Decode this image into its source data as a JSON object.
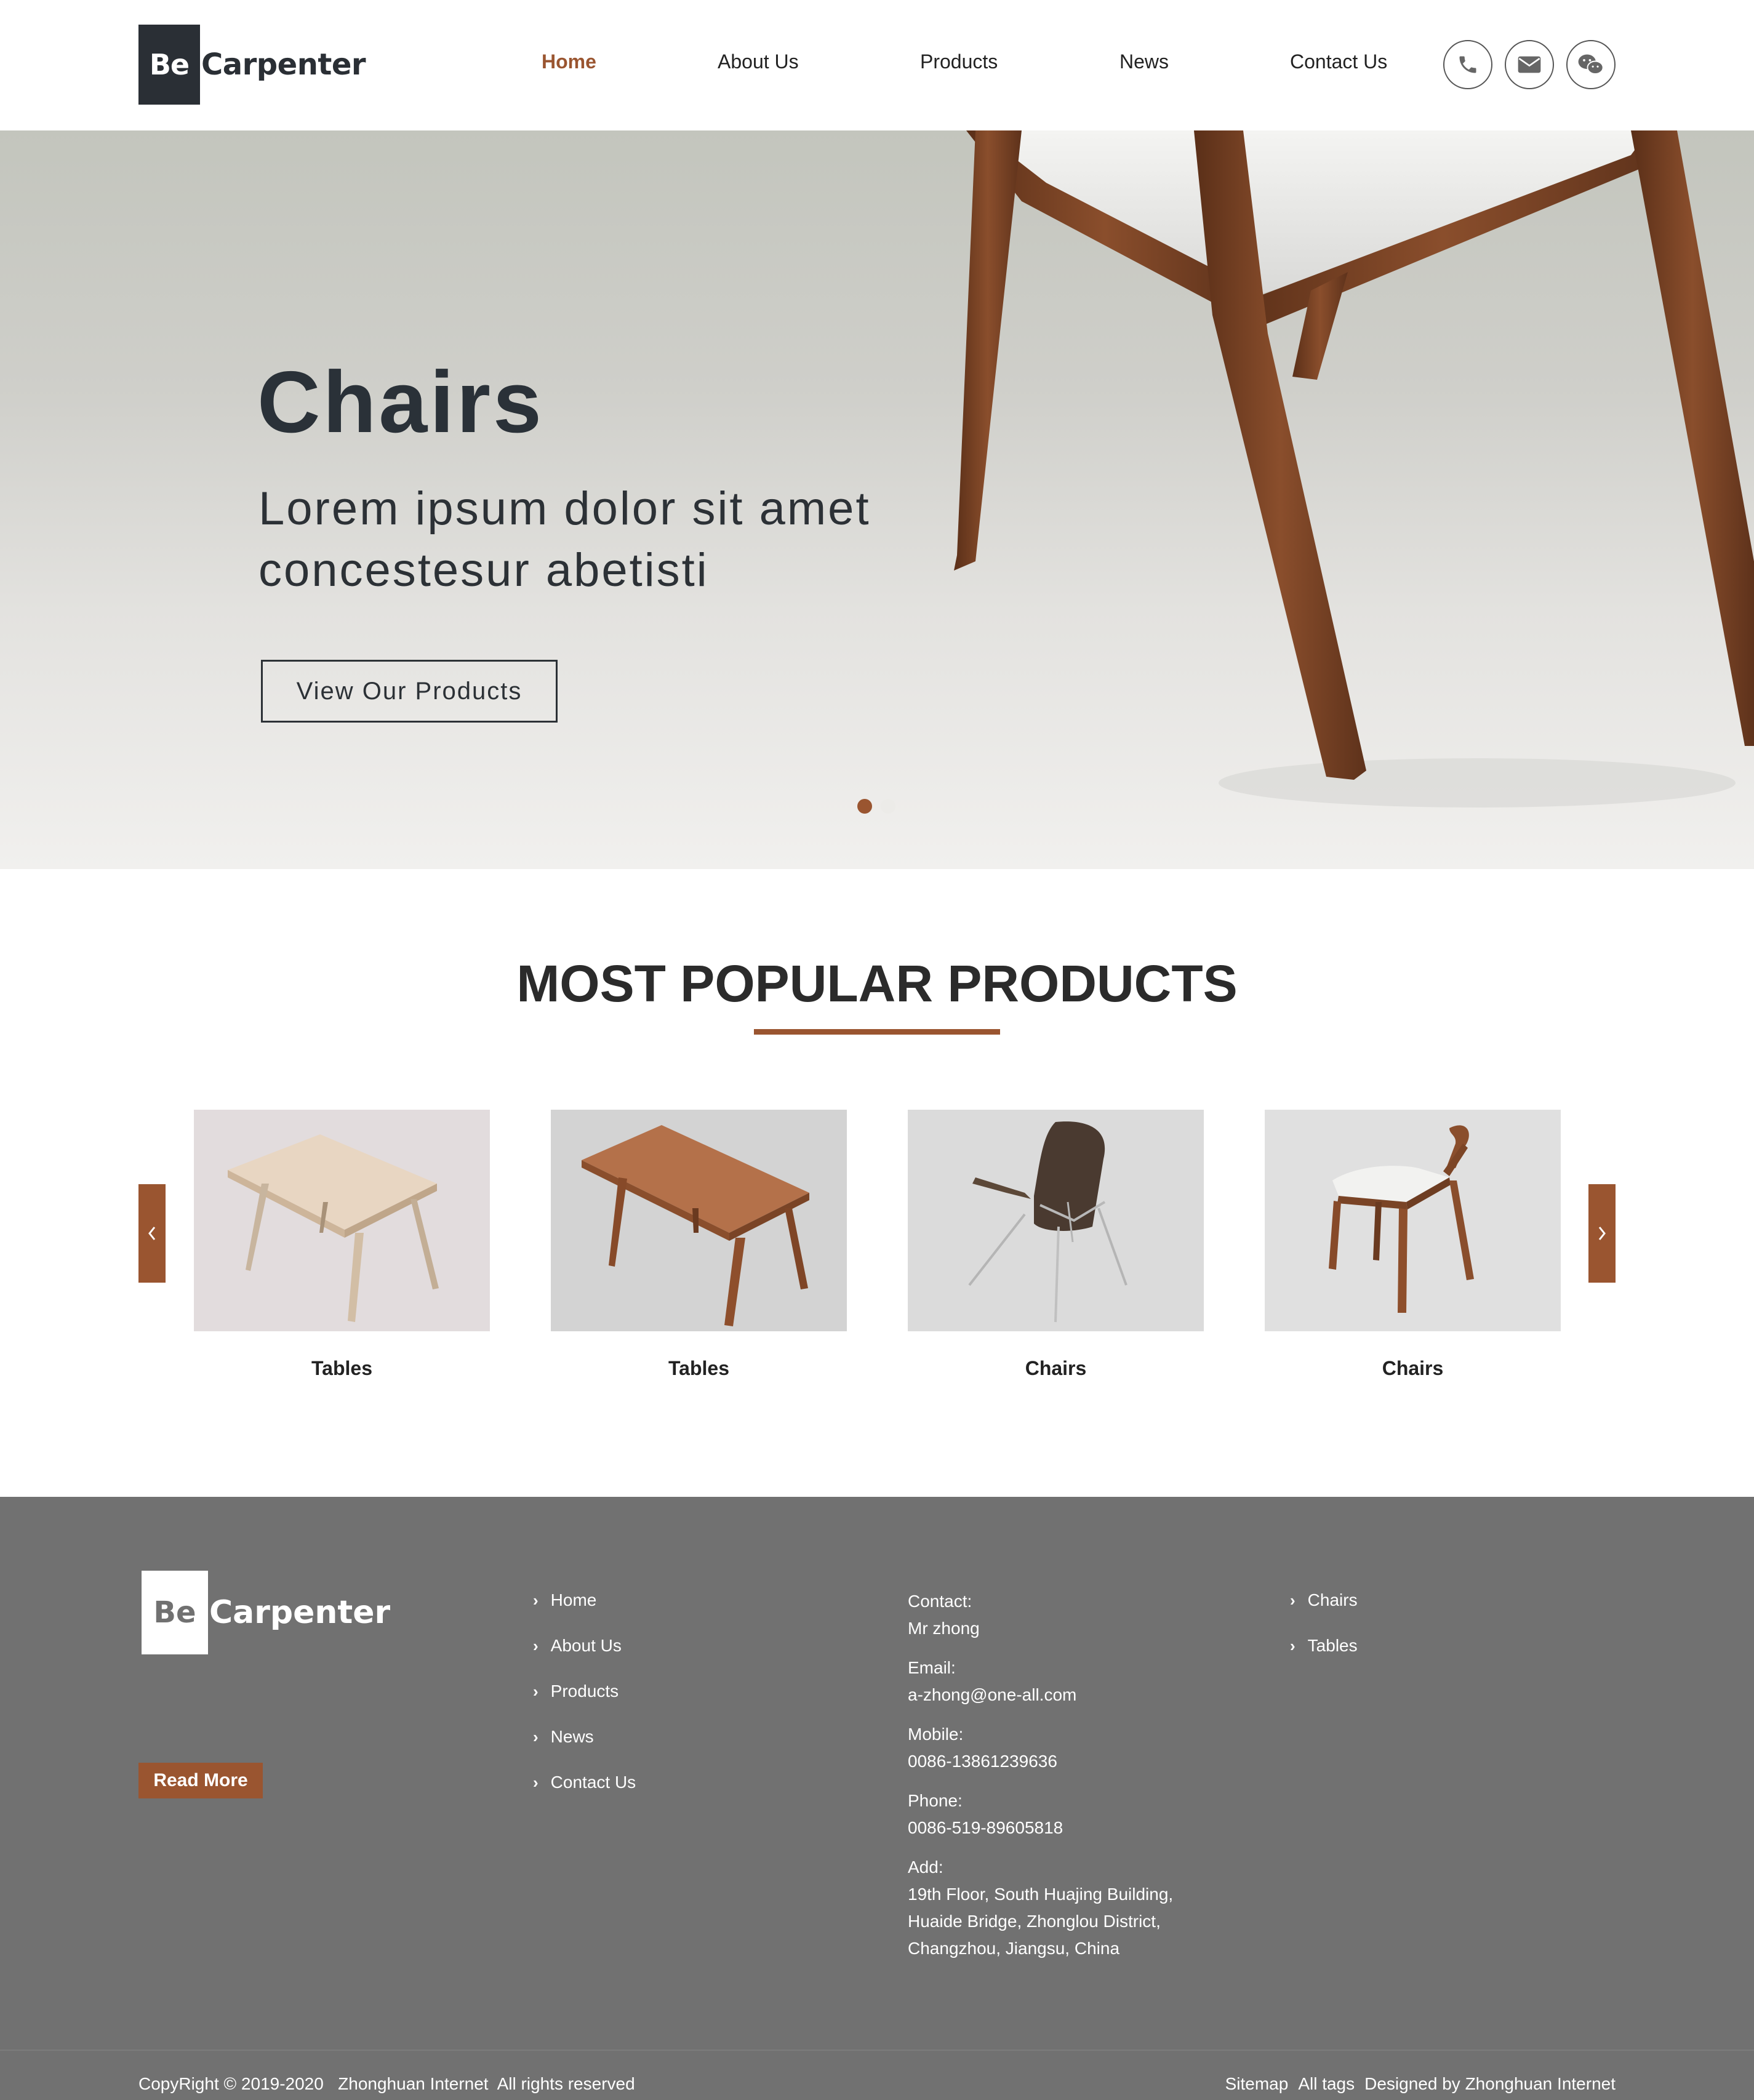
{
  "header": {
    "logo_be": "Be",
    "logo_word": "Carpenter",
    "nav": [
      "Home",
      "About Us",
      "Products",
      "News",
      "Contact Us"
    ],
    "active_nav": "Home",
    "contact_icons": [
      "phone-icon",
      "envelope-icon",
      "wechat-icon"
    ]
  },
  "hero": {
    "title": "Chairs",
    "subtitle": "Lorem ipsum dolor sit amet concestesur abetisti",
    "button": "View Our Products",
    "slide_count": 2,
    "active_slide": 1
  },
  "products": {
    "title": "MOST POPULAR PRODUCTS",
    "items": [
      {
        "label": "Tables"
      },
      {
        "label": "Tables"
      },
      {
        "label": "Chairs"
      },
      {
        "label": "Chairs"
      }
    ]
  },
  "footer": {
    "logo_be": "Be",
    "logo_word": "Carpenter",
    "read_more": "Read More",
    "nav_links": [
      "Home",
      "About Us",
      "Products",
      "News",
      "Contact Us"
    ],
    "contact": {
      "contact_label": "Contact:",
      "contact_value": "Mr zhong",
      "email_label": "Email:",
      "email_value": "a-zhong@one-all.com",
      "mobile_label": "Mobile:",
      "mobile_value": "0086-13861239636",
      "phone_label": "Phone:",
      "phone_value": "0086-519-89605818",
      "add_label": "Add:",
      "add_lines": [
        "19th Floor, South Huajing Building,",
        "Huaide Bridge, Zhonglou District,",
        "Changzhou, Jiangsu, China"
      ]
    },
    "categories": [
      "Chairs",
      "Tables"
    ],
    "copyright": "CopyRight © 2019-2020   Zhonghuan Internet  All rights reserved",
    "bottom_links": [
      "Sitemap",
      "All tags",
      "Designed by Zhonghuan Internet"
    ]
  },
  "colors": {
    "accent": "#9a5530",
    "dark": "#2a2f35",
    "footer_bg": "#717171"
  }
}
